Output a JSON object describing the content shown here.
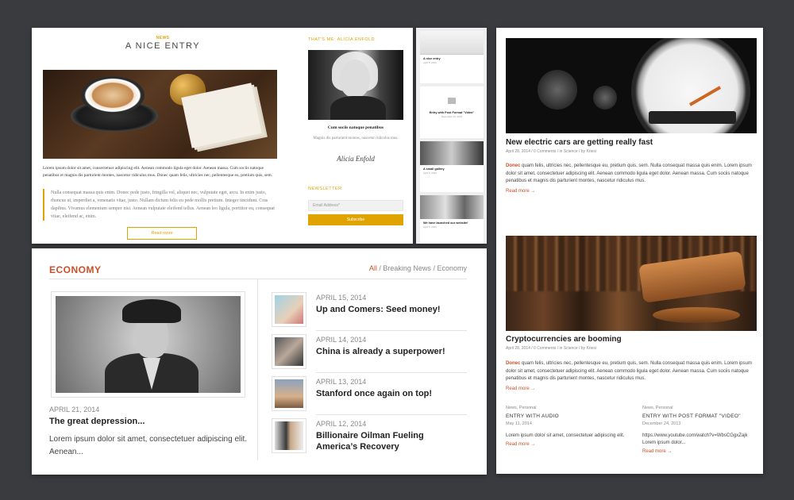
{
  "entry": {
    "category": "NEWS",
    "title": "A NICE ENTRY",
    "paragraph": "Lorem ipsum dolor sit amet, consectetuer adipiscing elit. Aenean commodo ligula eget dolor. Aenean massa. Cum sociis natoque penatibus et magnis dis parturient montes, nascetur ridiculus mus. Donec quam felis, ultricies nec, pellentesque eu, pretium quis, sem.",
    "quote": "Nulla consequat massa quis enim. Donec pede justo, fringilla vel, aliquet nec, vulputate eget, arcu. In enim justo, rhoncus ut, imperdiet a, venenatis vitae, justo. Nullam dictum felis eu pede mollis pretium. Integer tincidunt. Cras dapibus. Vivamus elementum semper nisi. Aenean vulputate eleifend tellus. Aenean leo ligula, porttitor eu, consequat vitae, eleifend ac, enim.",
    "read_more": "Read more",
    "sidebar_title": "THAT'S ME: ALICIA ENFOLD",
    "caption": "Cum sociis natoque penatibus",
    "caption_sub": "Magnis dis parturient montes, nascetur ridiculus mus.",
    "signature": "Alicia Enfold",
    "newsletter_title": "NEWSLETTER",
    "email_placeholder": "Email Address*",
    "subscribe": "Subscribe"
  },
  "mobile": {
    "cards": [
      {
        "title": "A nice entry",
        "meta": "April 5, 2014"
      },
      {
        "title": "Entry with Post Format \"Video\"",
        "meta": "December 24, 2013"
      },
      {
        "title": "A small gallery",
        "meta": "April 5, 2014"
      },
      {
        "title": "We have launched our website!",
        "meta": "April 5, 2014"
      }
    ]
  },
  "economy": {
    "heading": "ECONOMY",
    "tabs": [
      "All",
      "Breaking News",
      "Economy"
    ],
    "feature": {
      "date": "APRIL 21, 2014",
      "title": "The great depression...",
      "excerpt": "Lorem ipsum dolor sit amet, consectetuer adipiscing elit. Aenean..."
    },
    "items": [
      {
        "date": "APRIL 15, 2014",
        "title": "Up and Comers: Seed money!"
      },
      {
        "date": "APRIL 14, 2014",
        "title": "China is already a superpower!"
      },
      {
        "date": "APRIL 13, 2014",
        "title": "Stanford once again on top!"
      },
      {
        "date": "APRIL 12, 2014",
        "title": "Billionaire Oilman Fueling America’s Recovery"
      }
    ]
  },
  "blog": {
    "posts": [
      {
        "title": "New electric cars are getting really fast",
        "meta": "April 28, 2014 / 0 Comments / in Science / by Kriesi",
        "lead": "Donec",
        "text": " quam felis, ultricies nec, pellentesque eu, pretium quis, sem. Nulla consequat massa quis enim. Lorem ipsum dolor sit amet, consectetuer adipiscing elit. Aenean commodo ligula eget dolor. Aenean massa. Cum sociis natoque penatibus et magnis dis parturient montes, nascetur ridiculus mus.",
        "more": "Read more →"
      },
      {
        "title": "Cryptocurrencies are booming",
        "meta": "April 28, 2014 / 0 Comments / in Science / by Kriesi",
        "lead": "Donec",
        "text": " quam felis, ultricies nec, pellentesque eu, pretium quis, sem. Nulla consequat massa quis enim. Lorem ipsum dolor sit amet, consectetuer adipiscing elit. Aenean commodo ligula eget dolor. Aenean massa. Cum sociis natoque penatibus et magnis dis parturient montes, nascetur ridiculus mus.",
        "more": "Read more →"
      }
    ],
    "cols": [
      {
        "cat": "News, Personal",
        "title": "ENTRY WITH AUDIO",
        "date": "May 11, 2014",
        "body": "Lorem ipsum dolor sit amet, consectetuer adipiscing elit.",
        "more": "Read more →"
      },
      {
        "cat": "News, Personal",
        "title": "ENTRY WITH POST FORMAT \"VIDEO\"",
        "date": "December 24, 2013",
        "body": "https://www.youtube.com/watch?v=WbsCGgxZajk Lorem ipsum dolor...",
        "more": "Read more →"
      }
    ]
  }
}
